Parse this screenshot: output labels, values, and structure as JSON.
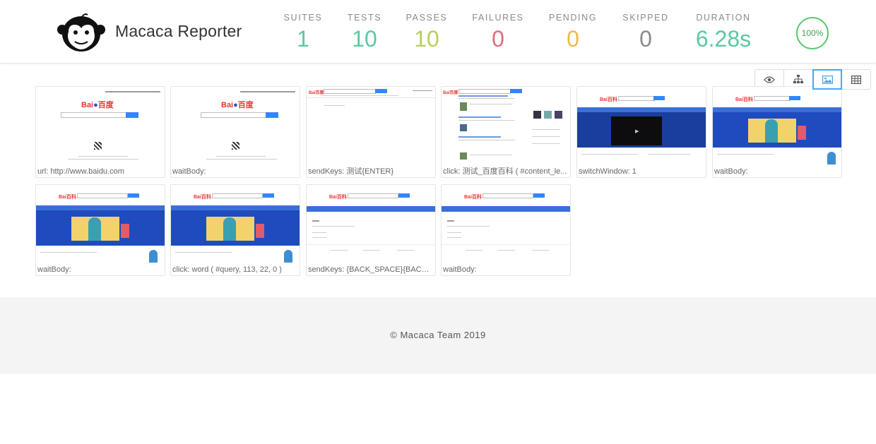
{
  "app": {
    "title": "Macaca Reporter"
  },
  "stats": [
    {
      "label": "SUITES",
      "value": "1",
      "color": "#5cc8a0"
    },
    {
      "label": "TESTS",
      "value": "10",
      "color": "#5cc8a0"
    },
    {
      "label": "PASSES",
      "value": "10",
      "color": "#b4d25a"
    },
    {
      "label": "FAILURES",
      "value": "0",
      "color": "#e06c7b"
    },
    {
      "label": "PENDING",
      "value": "0",
      "color": "#f0b84a"
    },
    {
      "label": "SKIPPED",
      "value": "0",
      "color": "#8a8a8a"
    },
    {
      "label": "DURATION",
      "value": "6.28s",
      "color": "#5cc8a0"
    }
  ],
  "pass_rate": "100%",
  "view_modes": [
    {
      "icon": "eye-icon",
      "active": false
    },
    {
      "icon": "sitemap-icon",
      "active": false
    },
    {
      "icon": "image-icon",
      "active": true
    },
    {
      "icon": "table-icon",
      "active": false
    }
  ],
  "screenshots": [
    {
      "caption": "url: http://www.baidu.com",
      "kind": "home"
    },
    {
      "caption": "waitBody:",
      "kind": "home"
    },
    {
      "caption": "sendKeys: 测试{ENTER}",
      "kind": "search"
    },
    {
      "caption": "click: 测试_百度百科 ( #content_le...",
      "kind": "results"
    },
    {
      "caption": "switchWindow: 1",
      "kind": "baike-video"
    },
    {
      "caption": "waitBody:",
      "kind": "baike"
    },
    {
      "caption": "waitBody:",
      "kind": "baike"
    },
    {
      "caption": "click: word ( #query, 113, 22, 0 )",
      "kind": "baike"
    },
    {
      "caption": "sendKeys: {BACK_SPACE}{BACK_...",
      "kind": "baike-empty"
    },
    {
      "caption": "waitBody:",
      "kind": "baike-empty"
    }
  ],
  "footer": {
    "copyright": "© Macaca Team 2019"
  },
  "colors": {
    "accent": "#45a7f5",
    "baidu_blue": "#3385ff",
    "baike_blue": "#1f4bbf"
  }
}
